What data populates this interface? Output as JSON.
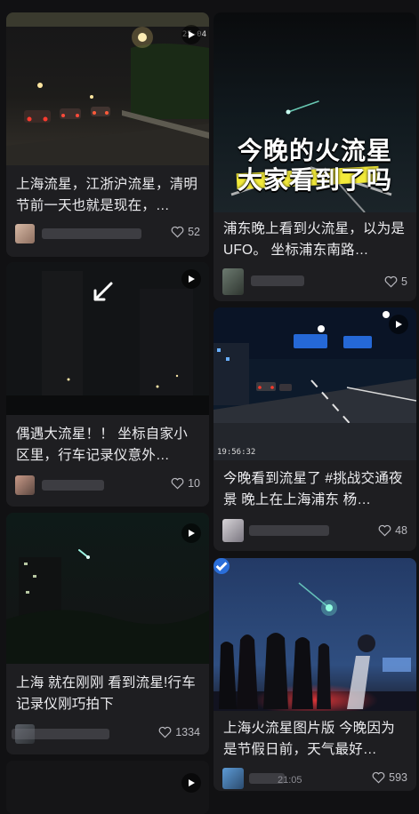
{
  "feed": {
    "left": [
      {
        "title": "上海流星，江浙沪流星，清明节前一天也就是现在，…",
        "likes": "52",
        "stamp": "25-04"
      },
      {
        "title": "偶遇大流星！！ 坐标自家小区里，行车记录仪意外…",
        "likes": "10"
      },
      {
        "title": "上海 就在刚刚 看到流星!行车记录仪刚巧拍下",
        "likes": "1334"
      }
    ],
    "right": [
      {
        "title": "浦东晚上看到火流星，以为是UFO。 坐标浦东南路…",
        "likes": "5",
        "overlay_line1": "今晚的火流星",
        "overlay_line2": "大家看到了吗"
      },
      {
        "title": "今晚看到流星了 #挑战交通夜景 晚上在上海浦东 杨…",
        "likes": "48",
        "stamp": "19:56:32"
      },
      {
        "title": "上海火流星图片版 今晚因为是节假日前，天气最好…",
        "likes": "593",
        "time": "21:05"
      }
    ]
  },
  "colors": {
    "accent_meteor": "#7ff5d8",
    "overlay_highlight": "#f2ea3a"
  }
}
